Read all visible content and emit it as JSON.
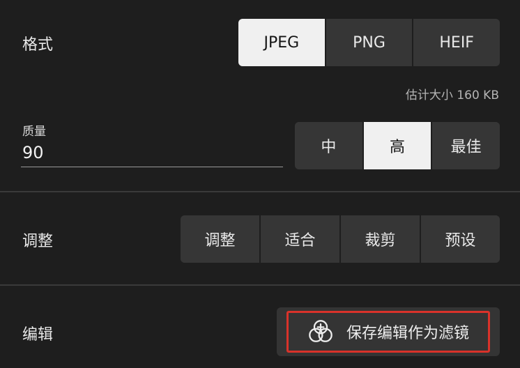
{
  "format": {
    "label": "格式",
    "options": [
      "JPEG",
      "PNG",
      "HEIF"
    ],
    "selected": "JPEG",
    "size_estimate": "估计大小 160 KB"
  },
  "quality": {
    "label": "质量",
    "value": "90",
    "options": [
      "中",
      "高",
      "最佳"
    ],
    "selected": "高"
  },
  "adjust": {
    "label": "调整",
    "options": [
      "调整",
      "适合",
      "裁剪",
      "预设"
    ]
  },
  "edit": {
    "label": "编辑",
    "save_as_filter_label": "保存编辑作为滤镜",
    "icon": "overlapping-circles-plus-icon"
  },
  "colors": {
    "background": "#1e1e1e",
    "segment": "#363636",
    "selected": "#f0f0f0",
    "highlight_border": "#d9322a"
  }
}
